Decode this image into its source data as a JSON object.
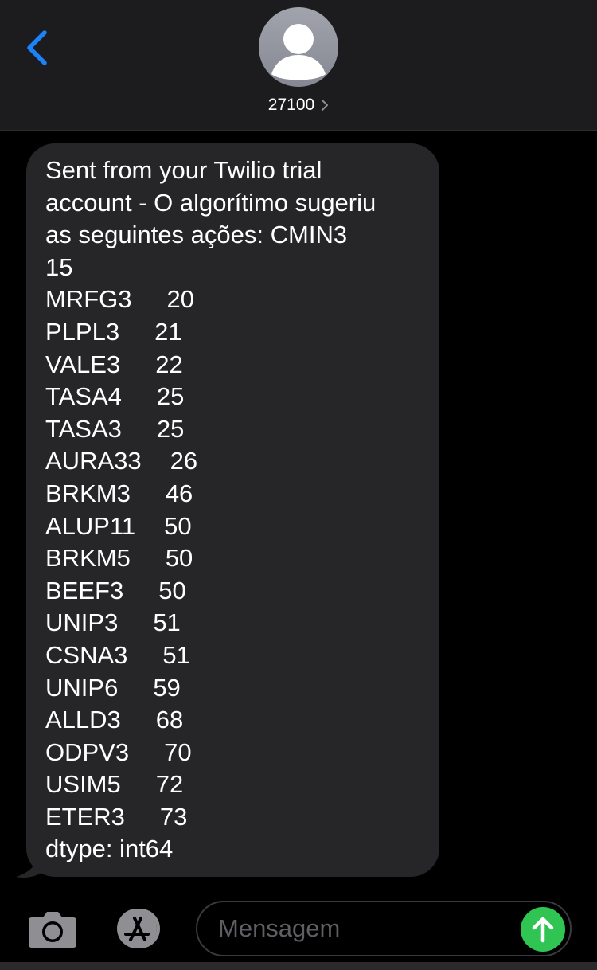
{
  "header": {
    "contact_name": "27100",
    "back_icon": "chevron-left-icon",
    "avatar_icon": "person-silhouette-icon",
    "accent_color": "#1a82fb"
  },
  "message": {
    "intro": "Sent from your Twilio trial\naccount - O algorítimo sugeriu\nas seguintes ações: CMIN3\n15",
    "rows": [
      {
        "ticker": "MRFG3",
        "value": "20"
      },
      {
        "ticker": "PLPL3",
        "value": "21"
      },
      {
        "ticker": "VALE3",
        "value": "22"
      },
      {
        "ticker": "TASA4",
        "value": "25"
      },
      {
        "ticker": "TASA3",
        "value": "25"
      },
      {
        "ticker": "AURA33",
        "value": "26"
      },
      {
        "ticker": "BRKM3",
        "value": "46"
      },
      {
        "ticker": "ALUP11",
        "value": "50"
      },
      {
        "ticker": "BRKM5",
        "value": "50"
      },
      {
        "ticker": "BEEF3",
        "value": "50"
      },
      {
        "ticker": "UNIP3",
        "value": "51"
      },
      {
        "ticker": "CSNA3",
        "value": "51"
      },
      {
        "ticker": "UNIP6",
        "value": "59"
      },
      {
        "ticker": "ALLD3",
        "value": "68"
      },
      {
        "ticker": "ODPV3",
        "value": "70"
      },
      {
        "ticker": "USIM5",
        "value": "72"
      },
      {
        "ticker": "ETER3",
        "value": "73"
      }
    ],
    "footer": "dtype: int64",
    "bubble_color": "#262629"
  },
  "composer": {
    "camera_icon": "camera-icon",
    "apps_icon": "app-store-icon",
    "placeholder": "Mensagem",
    "send_icon": "arrow-up-icon",
    "send_color": "#30c553"
  }
}
